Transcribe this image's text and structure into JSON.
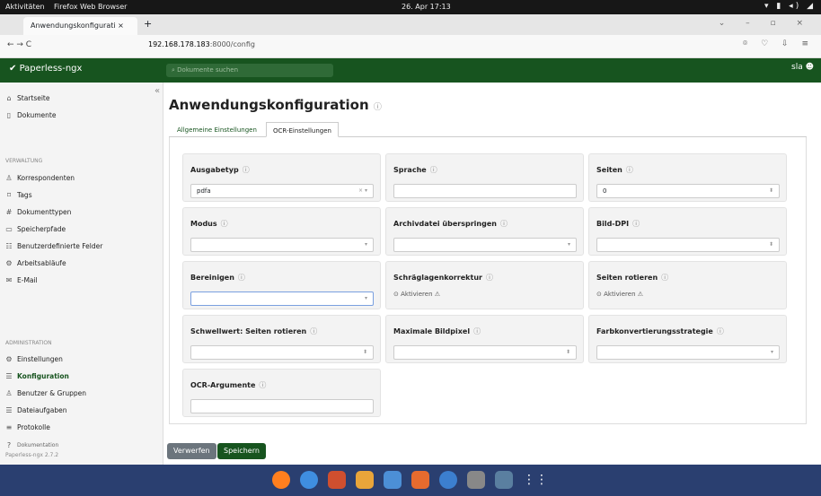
{
  "gnome": {
    "activities": "Aktivitäten",
    "app": "Firefox Web Browser",
    "datetime": "26. Apr  17:13"
  },
  "browser": {
    "tab_title": "Anwendungskonfigurati ×",
    "new_tab": "+",
    "url_host": "192.168.178.183",
    "url_path": ":8000/config",
    "nav": "←  →  C"
  },
  "app": {
    "brand": "Paperless-ngx",
    "search_placeholder": "Dokumente suchen",
    "user": "sla"
  },
  "sidebar": {
    "top": [
      {
        "label": "Startseite",
        "icon": "house-icon"
      },
      {
        "label": "Dokumente",
        "icon": "file-icon"
      }
    ],
    "verwaltung_header": "VERWALTUNG",
    "verwaltung": [
      {
        "label": "Korrespondenten"
      },
      {
        "label": "Tags"
      },
      {
        "label": "Dokumenttypen"
      },
      {
        "label": "Speicherpfade"
      },
      {
        "label": "Benutzerdefinierte Felder"
      },
      {
        "label": "Arbeitsabläufe"
      },
      {
        "label": "E-Mail"
      }
    ],
    "admin_header": "ADMINISTRATION",
    "admin": [
      {
        "label": "Einstellungen"
      },
      {
        "label": "Konfiguration"
      },
      {
        "label": "Benutzer & Gruppen"
      },
      {
        "label": "Dateiaufgaben"
      },
      {
        "label": "Protokolle"
      }
    ],
    "doc_label": "Dokumentation",
    "version": "Paperless-ngx 2.7.2"
  },
  "page": {
    "title": "Anwendungskonfiguration",
    "tabs": [
      "Allgemeine Einstellungen",
      "OCR-Einstellungen"
    ]
  },
  "fields": {
    "ausgabetyp": {
      "label": "Ausgabetyp",
      "value": "pdfa"
    },
    "sprache": {
      "label": "Sprache",
      "value": ""
    },
    "seiten": {
      "label": "Seiten",
      "value": "0"
    },
    "modus": {
      "label": "Modus",
      "value": ""
    },
    "archiv": {
      "label": "Archivdatei überspringen",
      "value": ""
    },
    "dpi": {
      "label": "Bild-DPI",
      "value": ""
    },
    "bereinigen": {
      "label": "Bereinigen",
      "value": ""
    },
    "schraeg": {
      "label": "Schräglagenkorrektur",
      "check": "Aktivieren"
    },
    "rotieren": {
      "label": "Seiten rotieren",
      "check": "Aktivieren"
    },
    "schwellwert": {
      "label": "Schwellwert: Seiten rotieren",
      "value": ""
    },
    "maxpixel": {
      "label": "Maximale Bildpixel",
      "value": ""
    },
    "farb": {
      "label": "Farbkonvertierungsstrategie",
      "value": ""
    },
    "ocrargs": {
      "label": "OCR-Argumente",
      "value": ""
    }
  },
  "buttons": {
    "discard": "Verwerfen",
    "save": "Speichern"
  },
  "colors": {
    "brand": "#17541f",
    "dock": "#2a3f70"
  }
}
